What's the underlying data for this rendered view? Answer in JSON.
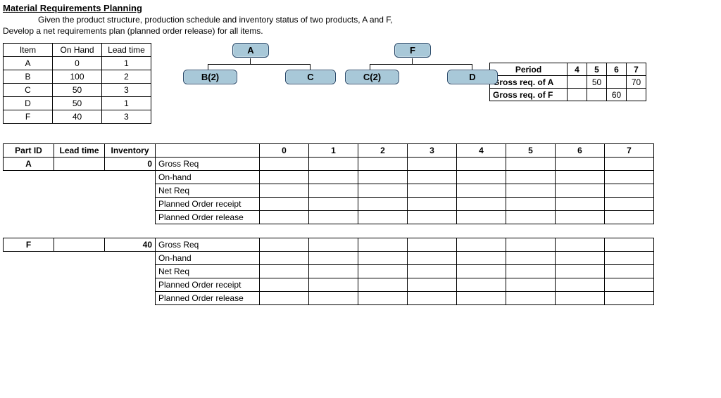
{
  "header": {
    "title": "Material Requirements Planning",
    "intro_line1": "Given the product structure, production schedule and inventory status of two products, A and F,",
    "intro_line2": "Develop a net requirements plan (planned order release) for all items."
  },
  "inv_table": {
    "headers": {
      "item": "Item",
      "on_hand": "On Hand",
      "lead_time": "Lead time"
    },
    "rows": [
      {
        "item": "A",
        "on_hand": "0",
        "lead_time": "1"
      },
      {
        "item": "B",
        "on_hand": "100",
        "lead_time": "2"
      },
      {
        "item": "C",
        "on_hand": "50",
        "lead_time": "3"
      },
      {
        "item": "D",
        "on_hand": "50",
        "lead_time": "1"
      },
      {
        "item": "F",
        "on_hand": "40",
        "lead_time": "3"
      }
    ]
  },
  "diagram": {
    "nodes": {
      "A": "A",
      "F": "F",
      "B2": "B(2)",
      "C": "C",
      "C2": "C(2)",
      "D": "D"
    }
  },
  "period_table": {
    "period_label": "Period",
    "periods": [
      "4",
      "5",
      "6",
      "7"
    ],
    "rows": [
      {
        "label": "Gross req. of A",
        "vals": [
          "",
          "50",
          "",
          "70"
        ]
      },
      {
        "label": "Gross req. of F",
        "vals": [
          "",
          "",
          "60",
          ""
        ]
      }
    ]
  },
  "mrp": {
    "headers": {
      "part_id": "Part ID",
      "lead_time": "Lead time",
      "inventory": "Inventory"
    },
    "periods": [
      "0",
      "1",
      "2",
      "3",
      "4",
      "5",
      "6",
      "7"
    ],
    "row_labels": {
      "gross_req": "Gross Req",
      "on_hand": "On-hand",
      "net_req": "Net Req",
      "por_receipt": "Planned Order receipt",
      "por_release": "Planned Order release"
    },
    "parts": [
      {
        "part_id": "A",
        "lead_time": "",
        "inventory": "0"
      },
      {
        "part_id": "F",
        "lead_time": "",
        "inventory": "40"
      }
    ]
  }
}
